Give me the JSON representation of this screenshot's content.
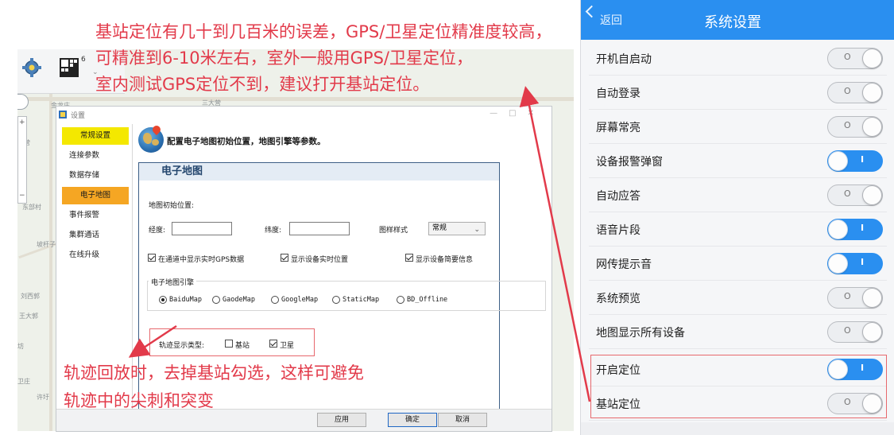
{
  "colors": {
    "annotation": "#e23a4a",
    "phone_header": "#2a8ff0",
    "nav_active_yellow": "#f4e800",
    "nav_active_orange": "#f5a623",
    "section_border": "#3d5f86"
  },
  "annotations": {
    "top_lines": [
      "基站定位有几十到几百米的误差，GPS/卫星定位精准度较高，",
      "可精准到6-10米左右，室外一般用GPS/卫星定位，",
      "室内测试GPS定位不到，建议打开基站定位。"
    ],
    "bottom_lines": [
      "轨迹回放时，去掉基站勾选，这样可避免",
      "轨迹中的尖刺和突变"
    ]
  },
  "map": {
    "toolbar_badge": "6",
    "labels": [
      "金龙庄",
      "三大营",
      "西营",
      "东部村",
      "坡杆子",
      "刘西郭",
      "王大郭",
      "坊",
      "卫庄",
      "许圩"
    ]
  },
  "dialog": {
    "title": "设置",
    "nav_items": [
      "常规设置",
      "连接参数",
      "数据存储",
      "电子地图",
      "事件报警",
      "集群通话",
      "在线升级"
    ],
    "header_text": "配置电子地图初始位置，地图引擎等参数。",
    "section_title": "电子地图",
    "initial_position_label": "地图初始位置:",
    "longitude_label": "经度:",
    "longitude_value": "",
    "latitude_label": "纬度:",
    "latitude_value": "",
    "style_label": "图样样式",
    "style_value": "常规",
    "checkboxes": [
      {
        "label": "在通道中显示实时GPS数据",
        "checked": true
      },
      {
        "label": "显示设备实时位置",
        "checked": true
      },
      {
        "label": "显示设备简要信息",
        "checked": true
      }
    ],
    "engine_legend": "电子地图引擎",
    "engines": [
      {
        "label": "BaiduMap",
        "selected": true
      },
      {
        "label": "GaodeMap",
        "selected": false
      },
      {
        "label": "GoogleMap",
        "selected": false
      },
      {
        "label": "StaticMap",
        "selected": false
      },
      {
        "label": "BD_Offline",
        "selected": false
      }
    ],
    "track_label": "轨迹显示类型:",
    "track_options": [
      {
        "label": "基站",
        "checked": false
      },
      {
        "label": "卫星",
        "checked": true
      }
    ],
    "buttons": {
      "apply": "应用",
      "ok": "确定",
      "cancel": "取消"
    }
  },
  "phone": {
    "back_label": "返回",
    "title": "系统设置",
    "on_mark": "I",
    "off_mark": "O",
    "settings": [
      {
        "label": "开机自启动",
        "on": false
      },
      {
        "label": "自动登录",
        "on": false
      },
      {
        "label": "屏幕常亮",
        "on": false
      },
      {
        "label": "设备报警弹窗",
        "on": true
      },
      {
        "label": "自动应答",
        "on": false
      },
      {
        "label": "语音片段",
        "on": true
      },
      {
        "label": "网传提示音",
        "on": true
      },
      {
        "label": "系统预览",
        "on": false
      },
      {
        "label": "地图显示所有设备",
        "on": false
      },
      {
        "label": "开启定位",
        "on": true
      },
      {
        "label": "基站定位",
        "on": false
      }
    ]
  }
}
